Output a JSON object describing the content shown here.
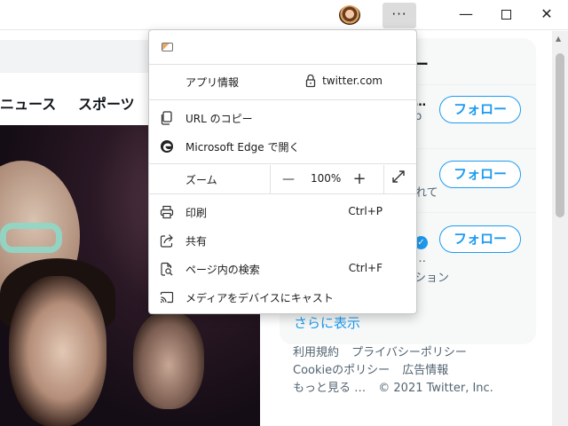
{
  "browser": {
    "more_button": "···",
    "minimize": "—",
    "close": "✕"
  },
  "page": {
    "tabs": [
      {
        "label": "ニュース"
      },
      {
        "label": "スポーツ"
      }
    ],
    "sidebar": {
      "heading_partial": "ー",
      "rows": [
        {
          "text_partial": "…",
          "sub_partial": "p",
          "follow_label": "フォロー"
        },
        {
          "text_partial": "れて",
          "follow_label": "フォロー"
        },
        {
          "text_partial": "…",
          "sub_partial": "ション",
          "follow_label": "フォロー"
        }
      ],
      "show_more": "さらに表示"
    },
    "footer": {
      "links": [
        "利用規約",
        "プライバシーポリシー",
        "Cookieのポリシー",
        "広告情報",
        "もっと見る …"
      ],
      "copyright": "© 2021 Twitter, Inc."
    }
  },
  "menu": {
    "app_info_label": "アプリ情報",
    "site": "twitter.com",
    "copy_url": "URL のコピー",
    "open_in_edge": "Microsoft Edge で開く",
    "zoom_label": "ズーム",
    "zoom_minus": "—",
    "zoom_value": "100%",
    "zoom_plus": "+",
    "print_label": "印刷",
    "print_shortcut": "Ctrl+P",
    "share_label": "共有",
    "find_label": "ページ内の検索",
    "find_shortcut": "Ctrl+F",
    "cast_label": "メディアをデバイスにキャスト"
  },
  "colors": {
    "twitter_blue": "#1d9bf0",
    "menu_border": "#c8c8c8"
  }
}
